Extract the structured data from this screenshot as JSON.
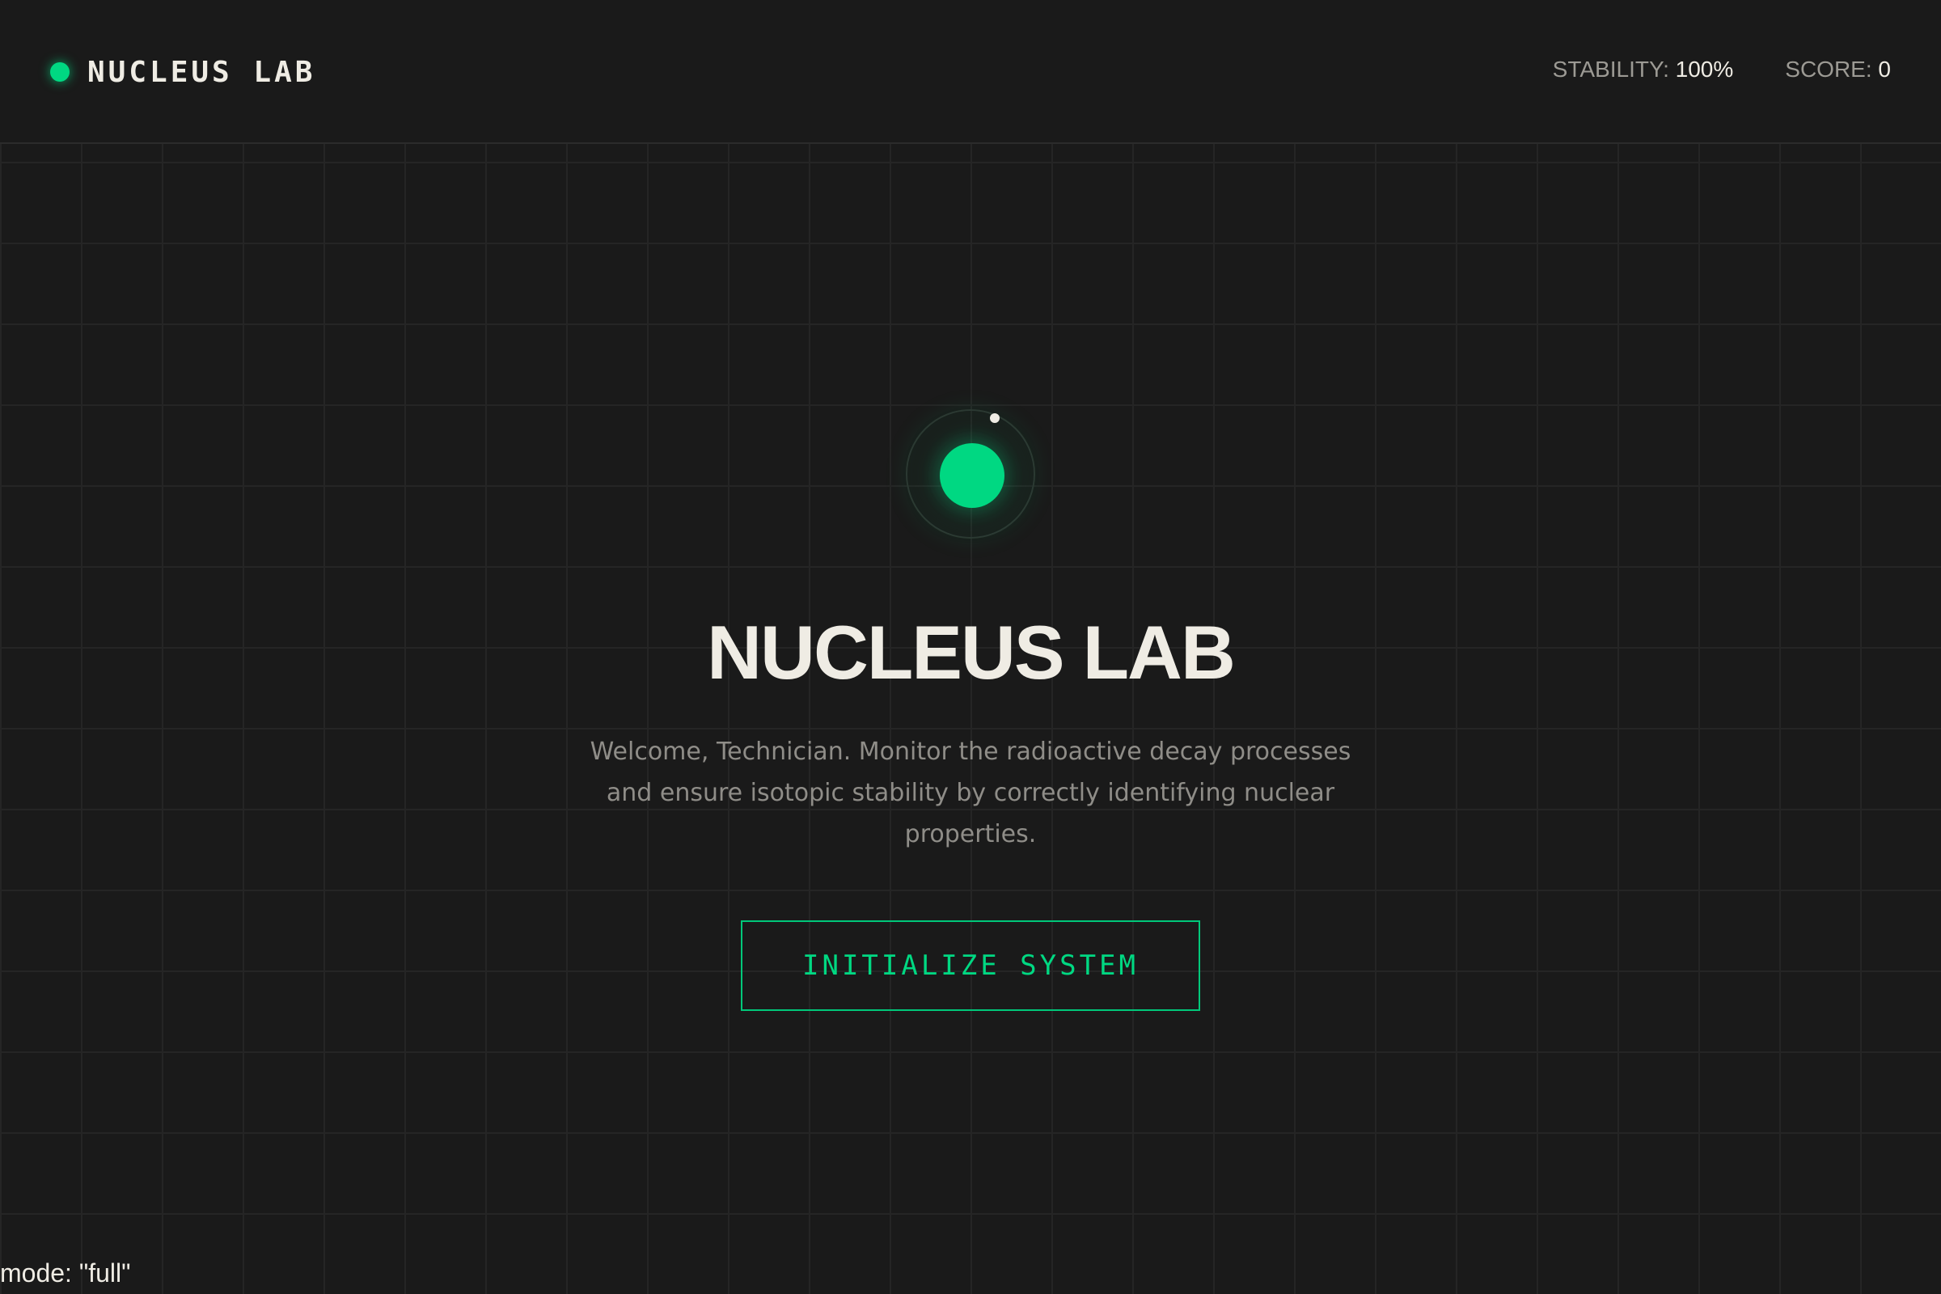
{
  "header": {
    "brand": "NUCLEUS LAB",
    "stats": [
      {
        "label": "STABILITY:",
        "value": "100%"
      },
      {
        "label": "SCORE:",
        "value": "0"
      }
    ]
  },
  "main": {
    "title": "NUCLEUS LAB",
    "description": "Welcome, Technician. Monitor the radioactive decay processes and ensure isotopic stability by correctly identifying nuclear properties.",
    "cta_label": "INITIALIZE SYSTEM"
  },
  "debug": {
    "text": "mode: \"full\""
  },
  "icons": {
    "brand": "status-dot-icon",
    "core": "atom-icon"
  },
  "colors": {
    "accent": "#00d882",
    "background": "#1a1a1a",
    "text": "#efece4",
    "muted": "#8f8d88"
  }
}
